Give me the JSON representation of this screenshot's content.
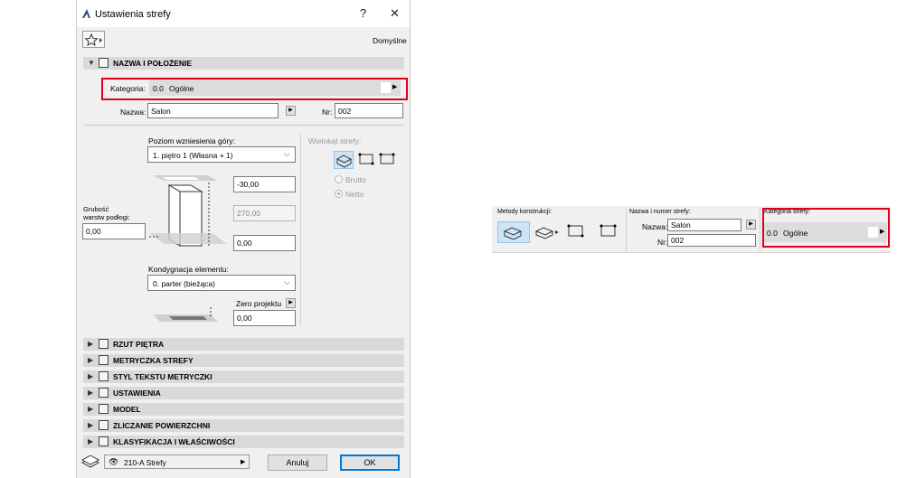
{
  "dialog": {
    "title": "Ustawienia strefy",
    "help_label": "?",
    "close_label": "✕",
    "favorites_label": "Domyślne",
    "sections": [
      {
        "label": "NAZWA I POŁOŻENIE",
        "expanded": true
      },
      {
        "label": "RZUT PIĘTRA"
      },
      {
        "label": "METRYCZKA STREFY"
      },
      {
        "label": "STYL TEKSTU METRYCZKI"
      },
      {
        "label": "USTAWIENIA"
      },
      {
        "label": "MODEL"
      },
      {
        "label": "ZLICZANIE POWIERZCHNI"
      },
      {
        "label": "KLASYFIKACJA I WŁAŚCIWOŚCI"
      }
    ],
    "category": {
      "label": "Kategoria:",
      "code": "0.0",
      "name": "Ogólne"
    },
    "name": {
      "label": "Nazwa:",
      "value": "Salon"
    },
    "number": {
      "label": "Nr:",
      "value": "002"
    },
    "top_level": {
      "label": "Poziom wzniesienia góry:",
      "value": "1. piętro 1 (Własna + 1)"
    },
    "top_offset": "-30,00",
    "height": "270,00",
    "bottom_offset": "0,00",
    "floor_thickness": {
      "label_line1": "Grubość",
      "label_line2": "warstw podłogi:",
      "value": "0,00"
    },
    "home_story": {
      "label": "Kondygnacja elementu:",
      "value": "0. parter (bieżąca)"
    },
    "project_zero": {
      "label": "Zero projektu",
      "value": "0,00"
    },
    "polygon": {
      "label": "Wielokąt strefy:",
      "gross": "Brutto",
      "net": "Netto"
    },
    "footer": {
      "layer": "210-A Strefy",
      "cancel": "Anuluj",
      "ok": "OK"
    }
  },
  "infobox": {
    "construction_label": "Metody konstrukcji:",
    "name_number_label": "Nazwa i numer strefy:",
    "name_label": "Nazwa:",
    "name_value": "Salon",
    "nr_label": "Nr:",
    "nr_value": "002",
    "category_label": "Kategoria strefy:",
    "category_code": "0.0",
    "category_name": "Ogólne"
  },
  "colors": {
    "highlight": "#e0001b",
    "accent": "#0078d7"
  }
}
